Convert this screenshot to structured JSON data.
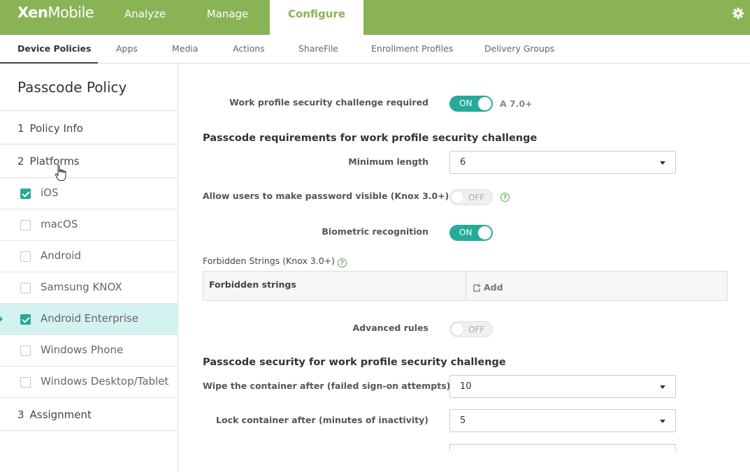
{
  "app": {
    "logo_bold": "Xen",
    "logo_rest": "Mobile"
  },
  "topnav": {
    "analyze": "Analyze",
    "manage": "Manage",
    "configure": "Configure"
  },
  "subnav": {
    "device_policies": "Device Policies",
    "apps": "Apps",
    "media": "Media",
    "actions": "Actions",
    "sharefile": "ShareFile",
    "enrollment_profiles": "Enrollment Profiles",
    "delivery_groups": "Delivery Groups"
  },
  "sidebar": {
    "title": "Passcode Policy",
    "step1": {
      "num": "1",
      "label": "Policy Info"
    },
    "step2": {
      "num": "2",
      "label": "Platforms"
    },
    "step3": {
      "num": "3",
      "label": "Assignment"
    },
    "platforms": [
      {
        "label": "iOS",
        "checked": true
      },
      {
        "label": "macOS",
        "checked": false
      },
      {
        "label": "Android",
        "checked": false
      },
      {
        "label": "Samsung KNOX",
        "checked": false
      },
      {
        "label": "Android Enterprise",
        "checked": true,
        "selected": true
      },
      {
        "label": "Windows Phone",
        "checked": false
      },
      {
        "label": "Windows Desktop/Tablet",
        "checked": false
      }
    ]
  },
  "form": {
    "work_profile_label": "Work profile security challenge required",
    "work_profile_toggle": "ON",
    "work_profile_version": "A 7.0+",
    "section_requirements": "Passcode requirements for work profile security challenge",
    "min_length_label": "Minimum length",
    "min_length_value": "6",
    "password_visible_label": "Allow users to make password visible (Knox 3.0+)",
    "password_visible_toggle": "OFF",
    "biometric_label": "Biometric recognition",
    "biometric_toggle": "ON",
    "forbidden_label": "Forbidden Strings (Knox 3.0+)",
    "forbidden_header": "Forbidden strings",
    "forbidden_add": "Add",
    "advanced_label": "Advanced rules",
    "advanced_toggle": "OFF",
    "section_security": "Passcode security for work profile security challenge",
    "wipe_label": "Wipe the container after (failed sign-on attempts)",
    "wipe_value": "10",
    "lock_label": "Lock container after (minutes of inactivity)",
    "lock_value": "5",
    "help_glyph": "?"
  },
  "colors": {
    "brand": "#8ab356",
    "accent": "#26aa9a",
    "selected_row": "#d4f2f0"
  }
}
